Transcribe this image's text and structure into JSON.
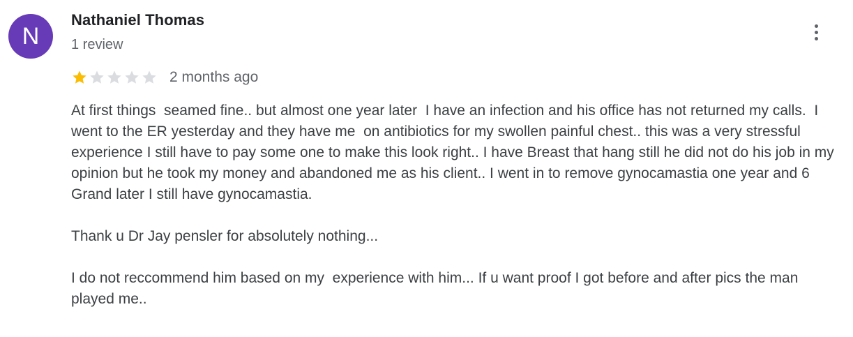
{
  "review": {
    "avatar_letter": "N",
    "avatar_color": "#673ab7",
    "author_name": "Nathaniel Thomas",
    "review_count": "1 review",
    "rating": 1,
    "rating_max": 5,
    "star_filled_color": "#fbbc04",
    "star_empty_color": "#dadce0",
    "date": "2 months ago",
    "more_icon": "more-vert-icon",
    "paragraphs": [
      "At first things  seamed fine.. but almost one year later  I have an infection and his office has not returned my calls.  I went to the ER yesterday and they have me  on antibiotics for my swollen painful chest.. this was a very stressful experience I still have to pay some one to make this look right.. I have Breast that hang still he did not do his job in my opinion but he took my money and abandoned me as his client.. I went in to remove gynocamastia one year and 6 Grand later I still have gynocamastia.",
      "Thank u Dr Jay pensler for absolutely nothing...",
      "I do not reccommend him based on my  experience with him... If u want proof I got before and after pics the man played me.."
    ]
  }
}
